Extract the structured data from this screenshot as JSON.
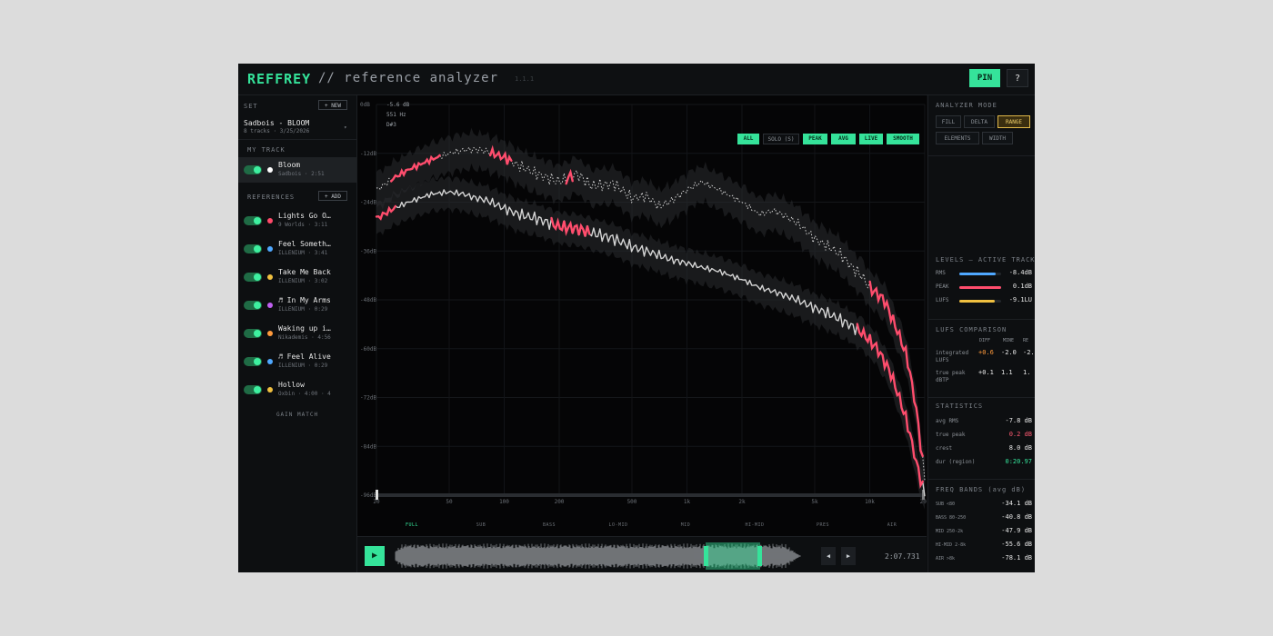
{
  "header": {
    "brand": "REFFREY",
    "subtitle": "// reference analyzer",
    "version": "1.1.1",
    "pin_label": "PIN",
    "help_label": "?"
  },
  "sidebar": {
    "set_label": "SET",
    "new_label": "+ NEW",
    "set_name": "Sadbois - BLOOM",
    "set_meta": "8 tracks · 3/25/2026",
    "set_caret": "▾",
    "my_track_label": "MY TRACK",
    "my_track": {
      "name": "Bloom",
      "meta": "Sadbois · 2:51",
      "color": "#ffffff"
    },
    "references_label": "REFERENCES",
    "add_label": "+ ADD",
    "references": [
      {
        "name": "Lights Go O…",
        "meta": "9 Worlds · 3:11",
        "color": "#ff4a6a"
      },
      {
        "name": "Feel Someth…",
        "meta": "ILLENIUM · 3:41",
        "color": "#4fa8ff"
      },
      {
        "name": "Take Me Back",
        "meta": "ILLENIUM · 3:02",
        "color": "#f0c040"
      },
      {
        "name": "♬ In My Arms",
        "meta": "ILLENIUM · 0:29",
        "color": "#c060f0"
      },
      {
        "name": "Waking up i…",
        "meta": "Nikademis · 4:56",
        "color": "#ff9a3c"
      },
      {
        "name": "♬ Feel Alive",
        "meta": "ILLENIUM · 0:29",
        "color": "#4fa8ff"
      },
      {
        "name": "Hollow",
        "meta": "Oxbin · 4:00 · 4",
        "color": "#f0c040"
      }
    ],
    "gain_match_label": "GAIN MATCH"
  },
  "chart": {
    "cursor": {
      "db": "-5.6 dB",
      "hz": "551 Hz",
      "note": "D#3"
    },
    "filters": [
      {
        "label": "ALL",
        "on": true
      },
      {
        "label": "SOLO (S)",
        "on": false
      },
      {
        "label": "PEAK",
        "on": true
      },
      {
        "label": "AVG",
        "on": true
      },
      {
        "label": "LIVE",
        "on": true
      },
      {
        "label": "SMOOTH",
        "on": true
      }
    ]
  },
  "chart_data": {
    "type": "line",
    "xscale": "log",
    "xlim": [
      20,
      20000
    ],
    "ylim": [
      -96,
      0
    ],
    "x_ticks": [
      "20",
      "50",
      "100",
      "200",
      "500",
      "1k",
      "2k",
      "5k",
      "10k",
      "20k"
    ],
    "y_ticks": [
      "0dB",
      "-12dB",
      "-24dB",
      "-36dB",
      "-48dB",
      "-60dB",
      "-72dB",
      "-84dB",
      "-96dB"
    ],
    "band_ticks": [
      "FULL",
      "SUB",
      "BASS",
      "LO-MID",
      "MID",
      "HI-MID",
      "PRES",
      "AIR"
    ],
    "series": [
      {
        "style": "peak",
        "x": [
          20,
          25,
          30,
          40,
          50,
          60,
          70,
          80,
          100,
          120,
          150,
          200,
          250,
          300,
          400,
          500,
          600,
          700,
          800,
          1000,
          1200,
          1500,
          2000,
          2500,
          3000,
          4000,
          5000,
          6000,
          7000,
          8000,
          9000,
          10000,
          12000,
          14000,
          16000,
          18000,
          20000
        ],
        "y": [
          -21,
          -18,
          -16,
          -13.5,
          -12,
          -11.2,
          -11,
          -11.5,
          -13,
          -15,
          -17,
          -19,
          -17,
          -20,
          -19.5,
          -23,
          -22.5,
          -25,
          -24,
          -21,
          -19,
          -21,
          -24,
          -27,
          -26,
          -29,
          -33,
          -35,
          -37,
          -40,
          -42,
          -45,
          -48,
          -55,
          -62,
          -75,
          -92
        ]
      },
      {
        "style": "avg",
        "x": [
          20,
          25,
          30,
          40,
          50,
          60,
          70,
          80,
          100,
          120,
          150,
          200,
          250,
          300,
          400,
          500,
          600,
          700,
          800,
          1000,
          1200,
          1500,
          2000,
          2500,
          3000,
          4000,
          5000,
          6000,
          7000,
          8000,
          9000,
          10000,
          11000,
          12000,
          13000,
          14000,
          16000,
          18000,
          20000
        ],
        "y": [
          -28,
          -25.5,
          -24,
          -22,
          -21.5,
          -22,
          -23,
          -23.5,
          -25.5,
          -27,
          -28,
          -30,
          -30.5,
          -31.5,
          -33,
          -35,
          -36,
          -37,
          -38,
          -39,
          -40,
          -41,
          -43,
          -45,
          -46,
          -48,
          -50,
          -51.5,
          -53,
          -54.5,
          -56,
          -58,
          -60,
          -63,
          -66,
          -70,
          -78,
          -88,
          -96
        ]
      }
    ],
    "highlight_color": "#ff4d6d",
    "band_color": "#2a2c30"
  },
  "transport": {
    "play_icon": "▶",
    "prev_icon": "◀",
    "next_icon": "▶",
    "timecode": "2:07.731"
  },
  "right_panel": {
    "mode_label": "ANALYZER MODE",
    "modes": [
      {
        "label": "FILL",
        "on": false
      },
      {
        "label": "DELTA",
        "on": false
      },
      {
        "label": "RANGE",
        "on": true
      },
      {
        "label": "ELEMENTS",
        "on": false
      },
      {
        "label": "WIDTH",
        "on": false
      }
    ],
    "levels_label": "LEVELS — ACTIVE TRACK",
    "levels": [
      {
        "label": "RMS",
        "value": "-8.4dB",
        "color": "#4fa8ff",
        "fill": 0.86
      },
      {
        "label": "PEAK",
        "value": "0.1dB",
        "color": "#ff4d6d",
        "fill": 1.0
      },
      {
        "label": "LUFS",
        "value": "-9.1LU",
        "color": "#f0c040",
        "fill": 0.84
      }
    ],
    "lufs_label": "LUFS COMPARISON",
    "lufs_cols": [
      "DIFF",
      "MINE",
      "RE"
    ],
    "lufs_rows": [
      {
        "label": "integrated LUFS",
        "diff": "+0.6",
        "mine": "-2.0",
        "ref": "-2."
      },
      {
        "label": "true peak dBTP",
        "diff": "+0.1",
        "mine": "1.1",
        "ref": "1."
      }
    ],
    "stats_label": "STATISTICS",
    "stats": [
      {
        "label": "avg RMS",
        "value": "-7.8 dB",
        "color": "#e8e8e8"
      },
      {
        "label": "true peak",
        "value": "0.2 dB",
        "color": "#ff5a72"
      },
      {
        "label": "crest",
        "value": "8.0 dB",
        "color": "#e8e8e8"
      },
      {
        "label": "dur (region)",
        "value": "0:20.97",
        "color": "#35e39a"
      }
    ],
    "bands_label": "FREQ BANDS (avg dB)",
    "bands": [
      {
        "label": "SUB <80",
        "value": "-34.1 dB"
      },
      {
        "label": "BASS 80-250",
        "value": "-40.8 dB"
      },
      {
        "label": "MID 250-2k",
        "value": "-47.9 dB"
      },
      {
        "label": "HI-MID 2-8k",
        "value": "-55.6 dB"
      },
      {
        "label": "AIR >8k",
        "value": "-78.1 dB"
      }
    ]
  }
}
